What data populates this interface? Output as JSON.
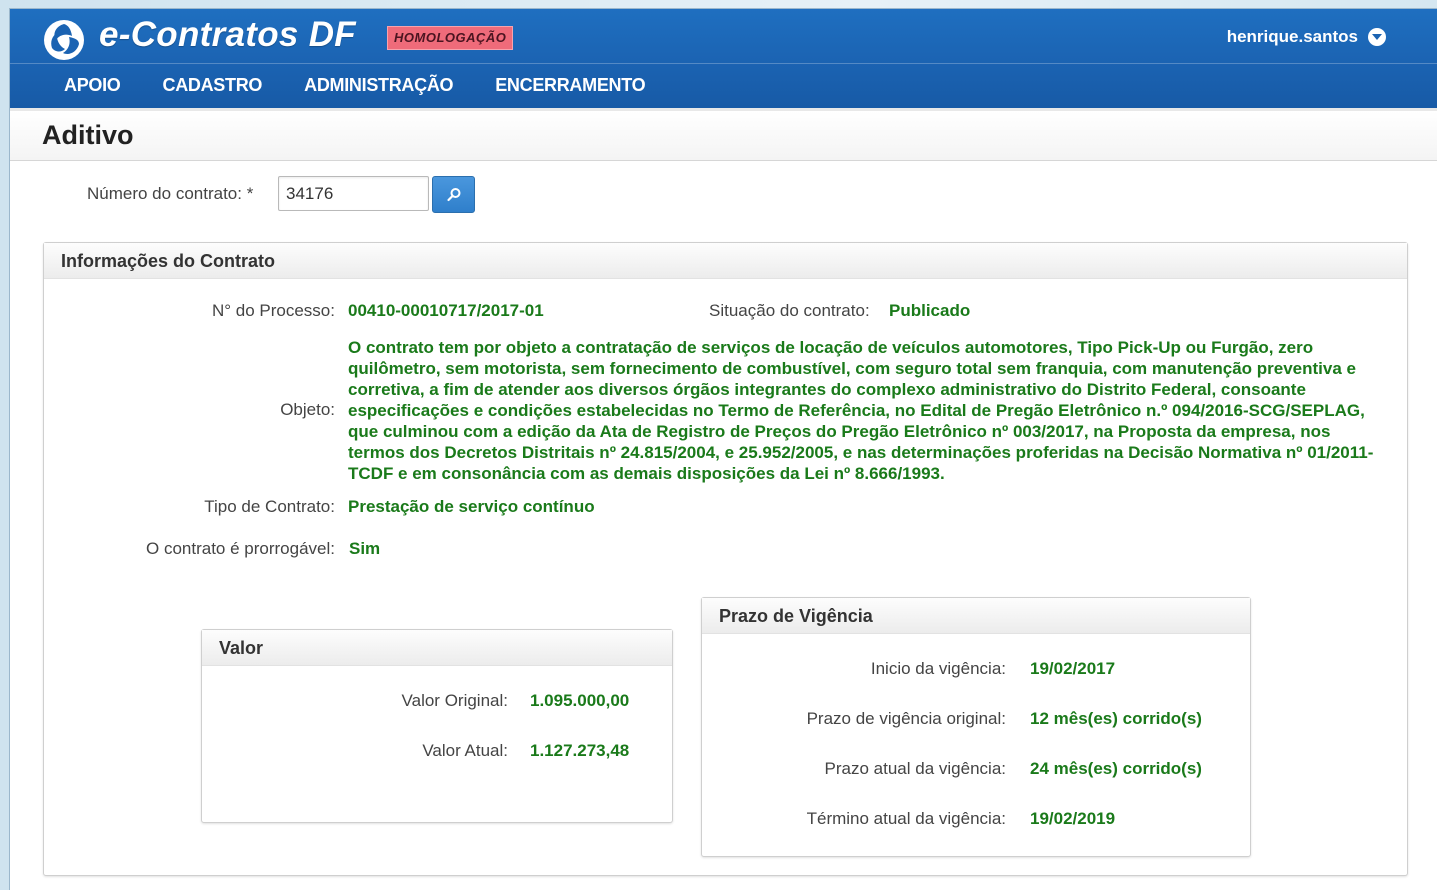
{
  "header": {
    "app_title": "e-Contratos DF",
    "env_badge": "HOMOLOGAÇÃO",
    "user": "henrique.santos",
    "nav": [
      "APOIO",
      "CADASTRO",
      "ADMINISTRAÇÃO",
      "ENCERRAMENTO"
    ]
  },
  "page": {
    "title": "Aditivo",
    "contract_number_label": "Número do contrato: *",
    "contract_number_value": "34176"
  },
  "info_panel": {
    "title": "Informações do Contrato",
    "processo_label": "N° do Processo:",
    "processo_value": "00410-00010717/2017-01",
    "situacao_label": "Situação do contrato:",
    "situacao_value": "Publicado",
    "objeto_label": "Objeto:",
    "objeto_value": "O contrato tem por objeto a contratação de serviços de locação de veículos automotores, Tipo Pick-Up ou Furgão, zero quilômetro, sem motorista, sem fornecimento de combustível, com seguro total sem franquia, com manutenção preventiva e corretiva, a fim de atender aos diversos órgãos integrantes do complexo administrativo do Distrito Federal, consoante especificações e condições estabelecidas no Termo de Referência, no Edital de Pregão Eletrônico n.º 094/2016-SCG/SEPLAG, que culminou com a edição da Ata de Registro de Preços do Pregão Eletrônico nº 003/2017, na Proposta da empresa, nos termos dos Decretos Distritais nº 24.815/2004, e 25.952/2005, e nas determinações proferidas na Decisão Normativa nº 01/2011-TCDF e em consonância com as demais disposições da Lei nº 8.666/1993.",
    "tipo_label": "Tipo de Contrato:",
    "tipo_value": "Prestação de serviço contínuo",
    "prorrogavel_label": "O contrato é prorrogável:",
    "prorrogavel_value": "Sim"
  },
  "valor_panel": {
    "title": "Valor",
    "original_label": "Valor Original:",
    "original_value": "1.095.000,00",
    "atual_label": "Valor Atual:",
    "atual_value": "1.127.273,48"
  },
  "prazo_panel": {
    "title": "Prazo de Vigência",
    "inicio_label": "Inicio da vigência:",
    "inicio_value": "19/02/2017",
    "original_label": "Prazo de vigência original:",
    "original_value": "12 mês(es) corrido(s)",
    "atual_label": "Prazo atual da vigência:",
    "atual_value": "24 mês(es) corrido(s)",
    "termino_label": "Término atual da vigência:",
    "termino_value": "19/02/2019"
  },
  "colors": {
    "header_blue": "#1b63b2",
    "value_green": "#1a7a1a",
    "badge_pink": "#ef6b7a"
  },
  "icons": {
    "logo": "e-contratos-logo-icon",
    "search": "search-icon",
    "user_caret": "chevron-down-circle-icon"
  }
}
